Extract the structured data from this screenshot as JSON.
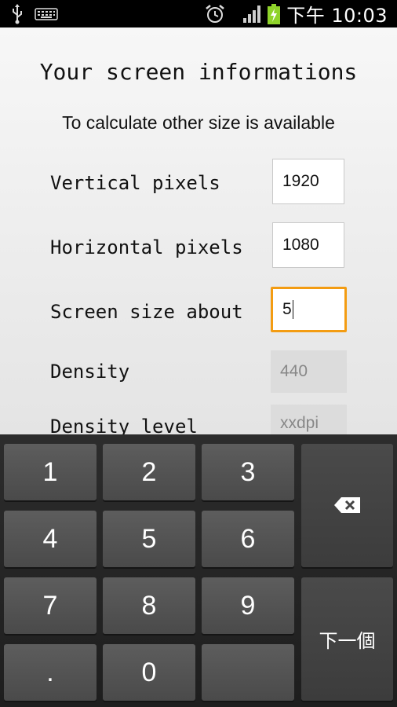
{
  "status_bar": {
    "time": "下午 10:03",
    "icons": [
      "usb-icon",
      "keyboard-icon",
      "alarm-icon",
      "signal-icon",
      "battery-charging-icon"
    ]
  },
  "app": {
    "title": "Your screen informations",
    "subtitle": "To calculate other size is available",
    "rows": [
      {
        "label": "Vertical pixels",
        "value": "1920"
      },
      {
        "label": "Horizontal pixels",
        "value": "1080"
      },
      {
        "label": "Screen size about",
        "value": "5"
      },
      {
        "label": "Density",
        "value": "440"
      },
      {
        "label": "Density level",
        "value": "xxdpi"
      }
    ]
  },
  "keyboard": {
    "keys": {
      "k1": "1",
      "k2": "2",
      "k3": "3",
      "k4": "4",
      "k5": "5",
      "k6": "6",
      "k7": "7",
      "k8": "8",
      "k9": "9",
      "dot": ".",
      "k0": "0",
      "blank": ""
    },
    "next_label": "下一個",
    "backspace_icon": "backspace-icon"
  }
}
